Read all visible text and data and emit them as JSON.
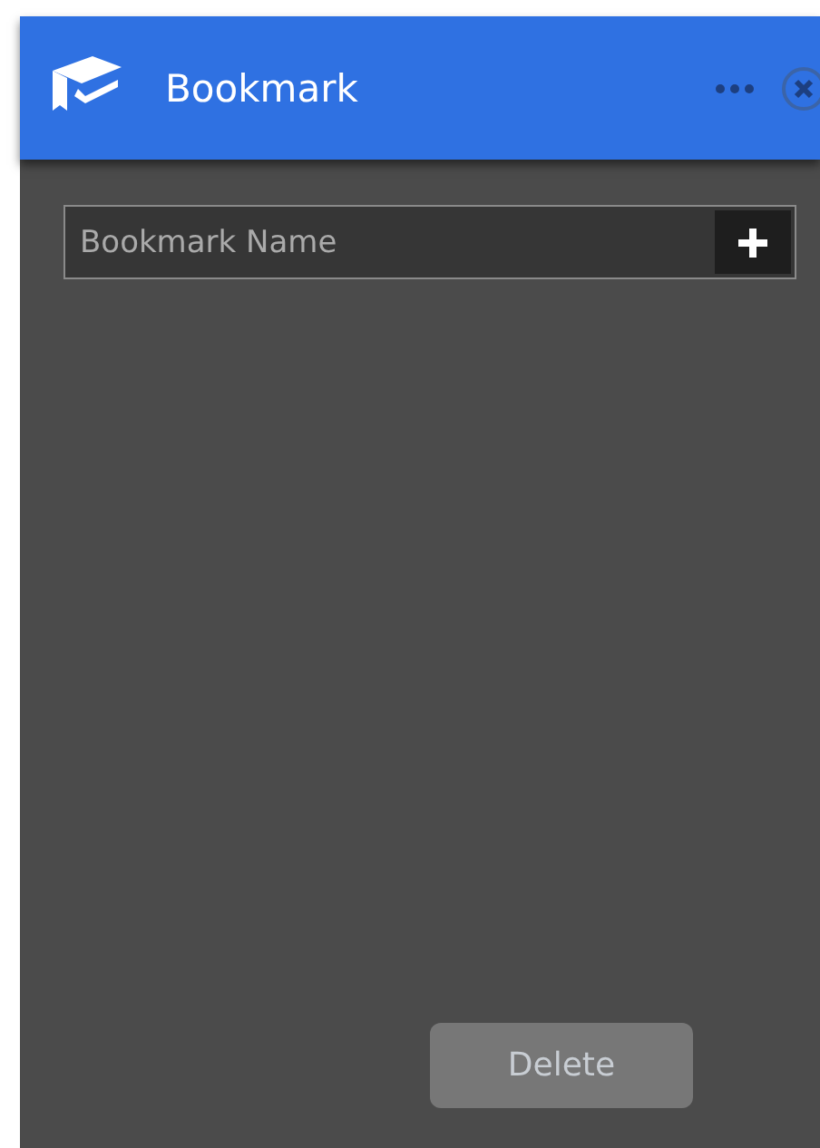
{
  "window": {
    "title": "Bookmark"
  },
  "name_field": {
    "placeholder": "Bookmark Name"
  },
  "delete_button": {
    "label": "Delete",
    "disabled": true
  }
}
